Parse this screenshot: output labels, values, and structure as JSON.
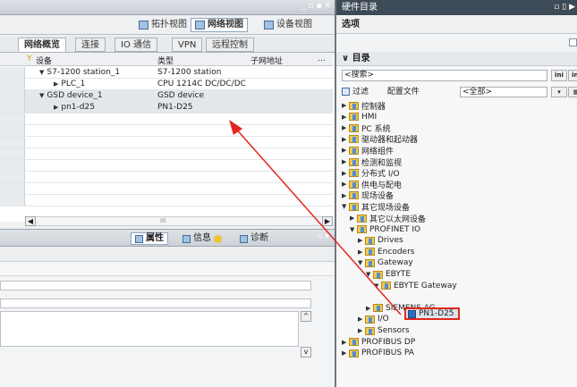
{
  "left_titlebar": {
    "controls": "_ ▫ ▪ ✕"
  },
  "view_tabs": [
    {
      "label": "拓扑视图"
    },
    {
      "label": "网络视图"
    },
    {
      "label": "设备视图"
    }
  ],
  "sub_tabs": [
    {
      "label": "网络概览"
    },
    {
      "label": "连接"
    },
    {
      "label": "IO 通信"
    },
    {
      "label": "VPN"
    },
    {
      "label": "远程控制"
    }
  ],
  "table": {
    "columns": [
      "设备",
      "类型",
      "子网地址",
      "..."
    ],
    "rows": [
      {
        "device": "S7-1200 station_1",
        "type": "S7-1200 station",
        "indent": 1,
        "expanded": true
      },
      {
        "device": "PLC_1",
        "type": "CPU 1214C DC/DC/DC",
        "indent": 2,
        "expanded": false
      },
      {
        "device": "GSD device_1",
        "type": "GSD device",
        "indent": 1,
        "expanded": true
      },
      {
        "device": "pn1-d25",
        "type": "PN1-D25",
        "indent": 2,
        "expanded": false
      }
    ],
    "hscroll_mark": "III"
  },
  "properties_bar": {
    "tabs": [
      {
        "label": "属性"
      },
      {
        "label": "信息"
      },
      {
        "label": "诊断"
      }
    ]
  },
  "right_panel": {
    "title": "硬件目录",
    "options_label": "选项",
    "catalog_header": "目录",
    "search_placeholder": "<搜索>",
    "search_btn1": "ini",
    "search_btn2": "ini",
    "filter_label": "过滤",
    "profile_label": "配置文件",
    "profile_value": "<全部>",
    "tree": [
      {
        "label": "控制器",
        "level": 0,
        "open": false
      },
      {
        "label": "HMI",
        "level": 0,
        "open": false
      },
      {
        "label": "PC 系统",
        "level": 0,
        "open": false
      },
      {
        "label": "驱动器和起动器",
        "level": 0,
        "open": false
      },
      {
        "label": "网络组件",
        "level": 0,
        "open": false
      },
      {
        "label": "检测和监视",
        "level": 0,
        "open": false
      },
      {
        "label": "分布式 I/O",
        "level": 0,
        "open": false
      },
      {
        "label": "供电与配电",
        "level": 0,
        "open": false
      },
      {
        "label": "现场设备",
        "level": 0,
        "open": false
      },
      {
        "label": "其它现场设备",
        "level": 0,
        "open": true
      },
      {
        "label": "其它以太网设备",
        "level": 1,
        "open": false
      },
      {
        "label": "PROFINET IO",
        "level": 1,
        "open": true
      },
      {
        "label": "Drives",
        "level": 2,
        "open": false
      },
      {
        "label": "Encoders",
        "level": 2,
        "open": false
      },
      {
        "label": "Gateway",
        "level": 2,
        "open": true
      },
      {
        "label": "EBYTE",
        "level": 3,
        "open": true
      },
      {
        "label": "EBYTE Gateway",
        "level": 4,
        "open": true
      },
      {
        "label": "SIEMENS AG",
        "level": 3,
        "open": false
      },
      {
        "label": "I/O",
        "level": 2,
        "open": false
      },
      {
        "label": "Sensors",
        "level": 2,
        "open": false
      },
      {
        "label": "PROFIBUS DP",
        "level": 0,
        "open": false
      },
      {
        "label": "PROFIBUS PA",
        "level": 0,
        "open": false
      }
    ],
    "selected_device": "PN1-D25"
  },
  "colors": {
    "highlight_box": "#e2261d",
    "arrow": "#e2261d"
  }
}
